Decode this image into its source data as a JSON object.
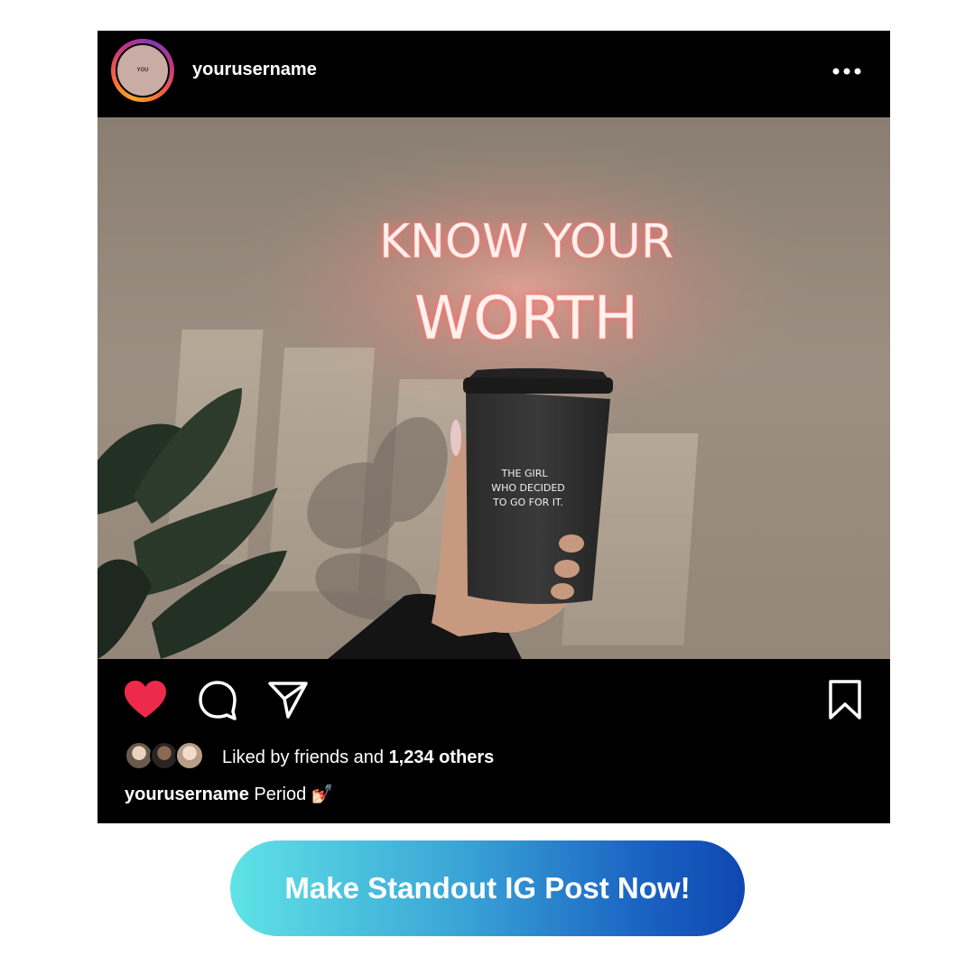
{
  "header": {
    "avatar_text": "YOU",
    "username": "yourusername",
    "more_icon": "more-horizontal-icon"
  },
  "photo": {
    "neon_line1": "KNOW YOUR",
    "neon_line2": "WORTH",
    "cup_line1": "THE GIRL",
    "cup_line2": "WHO DECIDED",
    "cup_line3": "TO GO FOR IT."
  },
  "actions": {
    "like_icon": "heart-filled-icon",
    "comment_icon": "comment-icon",
    "share_icon": "send-icon",
    "save_icon": "bookmark-icon",
    "like_color": "#ed2a4a"
  },
  "likes": {
    "prefix": "Liked by friends and ",
    "count": "1,234 others"
  },
  "caption": {
    "username": "yourusername",
    "text": "Period",
    "emoji": "💅🏻"
  },
  "cta": {
    "label": "Make Standout IG Post Now!"
  }
}
